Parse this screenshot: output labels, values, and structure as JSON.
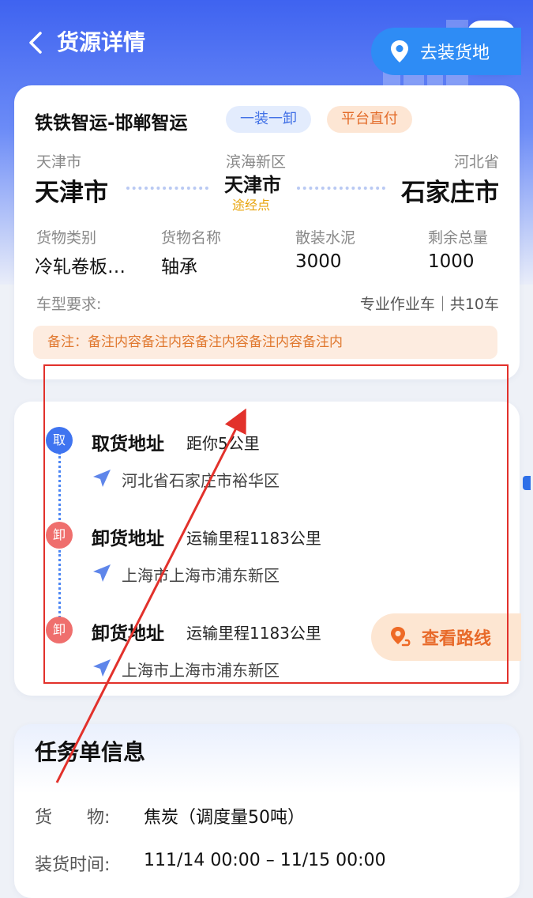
{
  "header": {
    "title": "货源详情",
    "back_icon": "chevron-left-icon",
    "phone_icon": "phone-icon"
  },
  "cargo": {
    "company": "铁铁智运-邯郸智运",
    "tags": [
      "一装一卸",
      "平台直付"
    ],
    "origin": {
      "sub": "天津市",
      "main": "天津市"
    },
    "via": {
      "sub": "滨海新区",
      "main": "天津市",
      "tag": "途经点"
    },
    "destination": {
      "sub": "河北省",
      "main": "石家庄市"
    },
    "attributes": [
      {
        "label": "货物类别",
        "value": "冷轧卷板…"
      },
      {
        "label": "货物名称",
        "value": "轴承"
      },
      {
        "label": "散装水泥",
        "value": "3000"
      },
      {
        "label": "剩余总量",
        "value": "1000"
      }
    ],
    "vehicle_label": "车型要求:",
    "vehicle_value": "专业作业车｜共10车",
    "remark": "备注：备注内容备注内容备注内容备注内容备注内"
  },
  "route": {
    "stops": [
      {
        "badge": "取",
        "title": "取货地址",
        "note": "距你5公里",
        "address": "河北省石家庄市裕华区"
      },
      {
        "badge": "卸",
        "title": "卸货地址",
        "note": "运输里程1183公里",
        "address": "上海市上海市浦东新区"
      },
      {
        "badge": "卸",
        "title": "卸货地址",
        "note": "运输里程1183公里",
        "address": "上海市上海市浦东新区"
      }
    ],
    "go_button": "去装货地",
    "route_button": "查看路线"
  },
  "task": {
    "title": "任务单信息",
    "rows": [
      {
        "label": "货　　物:",
        "value": "焦炭（调度量50吨）"
      },
      {
        "label": "装货时间:",
        "value": "111/14 00:00  –  11/15 00:00"
      }
    ]
  },
  "colors": {
    "primary": "#3f63f0",
    "annotation": "#e2312b",
    "orange": "#e36c2a"
  }
}
